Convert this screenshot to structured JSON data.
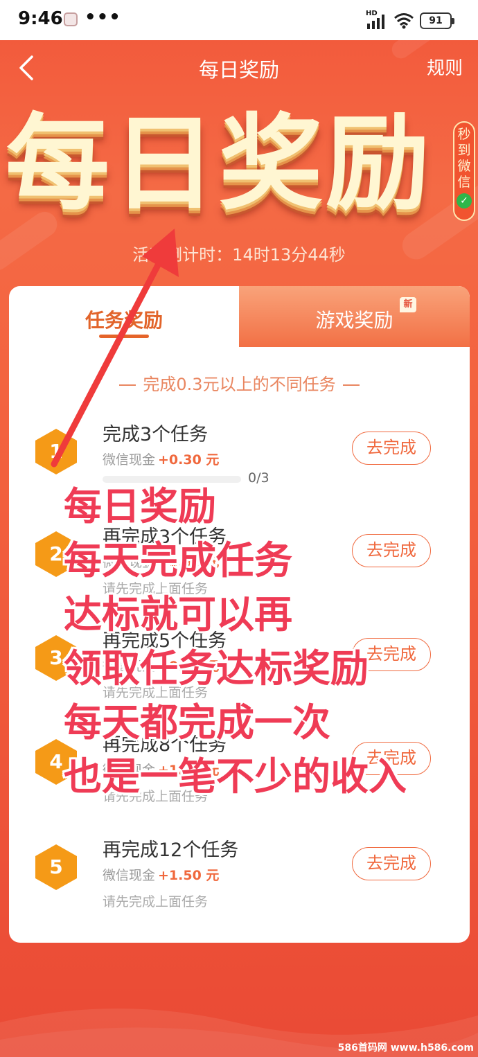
{
  "status_bar": {
    "time": "9:46",
    "dots": "•••",
    "hd": "HD",
    "battery": "91"
  },
  "header": {
    "title": "每日奖励",
    "rules": "规则"
  },
  "banner": {
    "title": "每日奖励",
    "tag": "秒到微信",
    "countdown": "活动倒计时：14时13分44秒"
  },
  "tabs": {
    "task": "任务奖励",
    "game": "游戏奖励",
    "new_badge": "新"
  },
  "subtitle": "完成0.3元以上的不同任务",
  "tasks": [
    {
      "num": "1",
      "title": "完成3个任务",
      "reward_label": "微信现金",
      "reward_value": "+0.30 元",
      "progress_text": "0/3",
      "progress": 0,
      "button": "去完成"
    },
    {
      "num": "2",
      "title": "再完成3个任务",
      "reward_label": "微信现金",
      "reward_value": "+0.50 元",
      "hint": "请先完成上面任务",
      "button": "去完成"
    },
    {
      "num": "3",
      "title": "再完成5个任务",
      "reward_label": "微信现金",
      "reward_value": "+0.80 元",
      "hint": "请先完成上面任务",
      "button": "去完成"
    },
    {
      "num": "4",
      "title": "再完成8个任务",
      "reward_label": "微信现金",
      "reward_value": "+1.00 元",
      "hint": "请先完成上面任务",
      "button": "去完成"
    },
    {
      "num": "5",
      "title": "再完成12个任务",
      "reward_label": "微信现金",
      "reward_value": "+1.50 元",
      "hint": "请先完成上面任务",
      "button": "去完成"
    }
  ],
  "overlay": {
    "lines": [
      "每日奖励",
      "每天完成任务",
      "达标就可以再",
      "领取任务达标奖励",
      "每天都完成一次",
      "也是一笔不少的收入"
    ]
  },
  "watermark": "586首码网 www.h586.com",
  "colors": {
    "accent": "#f0683d",
    "overlay_red": "#ef3b55",
    "hex_orange": "#f59a17"
  }
}
